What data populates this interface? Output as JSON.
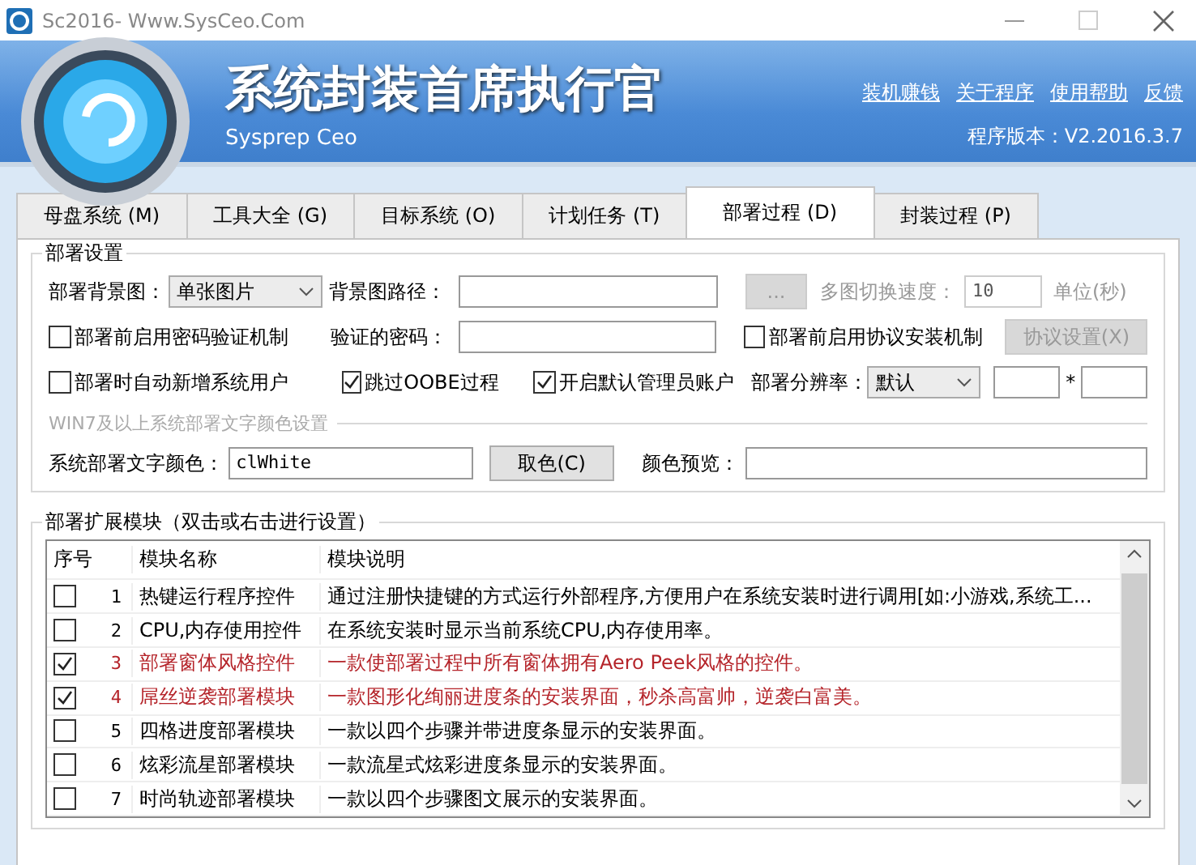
{
  "window": {
    "title": "Sc2016- Www.SysCeo.Com"
  },
  "header": {
    "title": "系统封装首席执行官",
    "subtitle": "Sysprep  Ceo",
    "links": [
      "装机赚钱",
      "关于程序",
      "使用帮助",
      "反馈"
    ],
    "version": "程序版本：V2.2016.3.7"
  },
  "tabs": [
    {
      "label": "母盘系统 (M)",
      "selected": false
    },
    {
      "label": "工具大全 (G)",
      "selected": false
    },
    {
      "label": "目标系统 (O)",
      "selected": false
    },
    {
      "label": "计划任务 (T)",
      "selected": false
    },
    {
      "label": "部署过程 (D)",
      "selected": true
    },
    {
      "label": "封装过程 (P)",
      "selected": false
    }
  ],
  "deploy_settings": {
    "title": "部署设置",
    "lines": [
      {
        "controls": [
          {
            "kind": "label",
            "text": "部署背景图："
          },
          {
            "kind": "select",
            "value": "单张图片"
          },
          {
            "kind": "label",
            "text": "背景图路径："
          },
          {
            "kind": "input"
          },
          {
            "kind": "button",
            "label": "...",
            "disabled": true
          },
          {
            "kind": "label",
            "text": "多图切换速度：",
            "disabled": true
          },
          {
            "kind": "input",
            "value": "10",
            "disabled": true
          },
          {
            "kind": "label",
            "text": "单位(秒)",
            "disabled": true
          }
        ]
      },
      {
        "controls": [
          {
            "kind": "checkbox",
            "text": "部署前启用密码验证机制",
            "checked": false
          },
          {
            "kind": "label",
            "text": "验证的密码："
          },
          {
            "kind": "input"
          },
          {
            "kind": "checkbox",
            "text": "部署前启用协议安装机制",
            "checked": false
          },
          {
            "kind": "button",
            "label": "协议设置(X)",
            "disabled": true
          }
        ]
      },
      {
        "controls": [
          {
            "kind": "checkbox",
            "text": "部署时自动新增系统用户",
            "checked": false
          },
          {
            "kind": "checkbox",
            "text": "跳过OOBE过程",
            "checked": true
          },
          {
            "kind": "checkbox",
            "text": "开启默认管理员账户",
            "checked": true
          },
          {
            "kind": "label",
            "text": "部署分辨率："
          },
          {
            "kind": "select",
            "value": "默认"
          },
          {
            "kind": "input"
          },
          {
            "kind": "label",
            "text": "*"
          },
          {
            "kind": "input"
          }
        ]
      }
    ],
    "color_section": {
      "title": "WIN7及以上系统部署文字颜色设置",
      "row": [
        {
          "kind": "label",
          "text": "系统部署文字颜色："
        },
        {
          "kind": "input",
          "value": "clWhite"
        },
        {
          "kind": "button",
          "label": "取色(C)",
          "disabled": false
        },
        {
          "kind": "label",
          "text": "颜色预览："
        },
        {
          "kind": "input"
        }
      ]
    }
  },
  "modules": {
    "title": "部署扩展模块（双击或右击进行设置）",
    "columns": [
      "序号",
      "模块名称",
      "模块说明"
    ],
    "rows": [
      {
        "checked": false,
        "index": "1",
        "name": "热键运行程序控件",
        "description": "通过注册快捷键的方式运行外部程序,方便用户在系统安装时进行调用[如:小游戏,系统工...",
        "color": "#000000"
      },
      {
        "checked": false,
        "index": "2",
        "name": "CPU,内存使用控件",
        "description": "在系统安装时显示当前系统CPU,内存使用率。",
        "color": "#000000"
      },
      {
        "checked": true,
        "index": "3",
        "name": "部署窗体风格控件",
        "description": "一款使部署过程中所有窗体拥有Aero Peek风格的控件。",
        "color": "#b5242a"
      },
      {
        "checked": true,
        "index": "4",
        "name": "屌丝逆袭部署模块",
        "description": "一款图形化绚丽进度条的安装界面，秒杀高富帅，逆袭白富美。",
        "color": "#b5242a"
      },
      {
        "checked": false,
        "index": "5",
        "name": "四格进度部署模块",
        "description": "一款以四个步骤并带进度条显示的安装界面。",
        "color": "#000000"
      },
      {
        "checked": false,
        "index": "6",
        "name": "炫彩流星部署模块",
        "description": "一款流星式炫彩进度条显示的安装界面。",
        "color": "#000000"
      },
      {
        "checked": false,
        "index": "7",
        "name": "时尚轨迹部署模块",
        "description": "一款以四个步骤图文展示的安装界面。",
        "color": "#000000"
      }
    ]
  }
}
